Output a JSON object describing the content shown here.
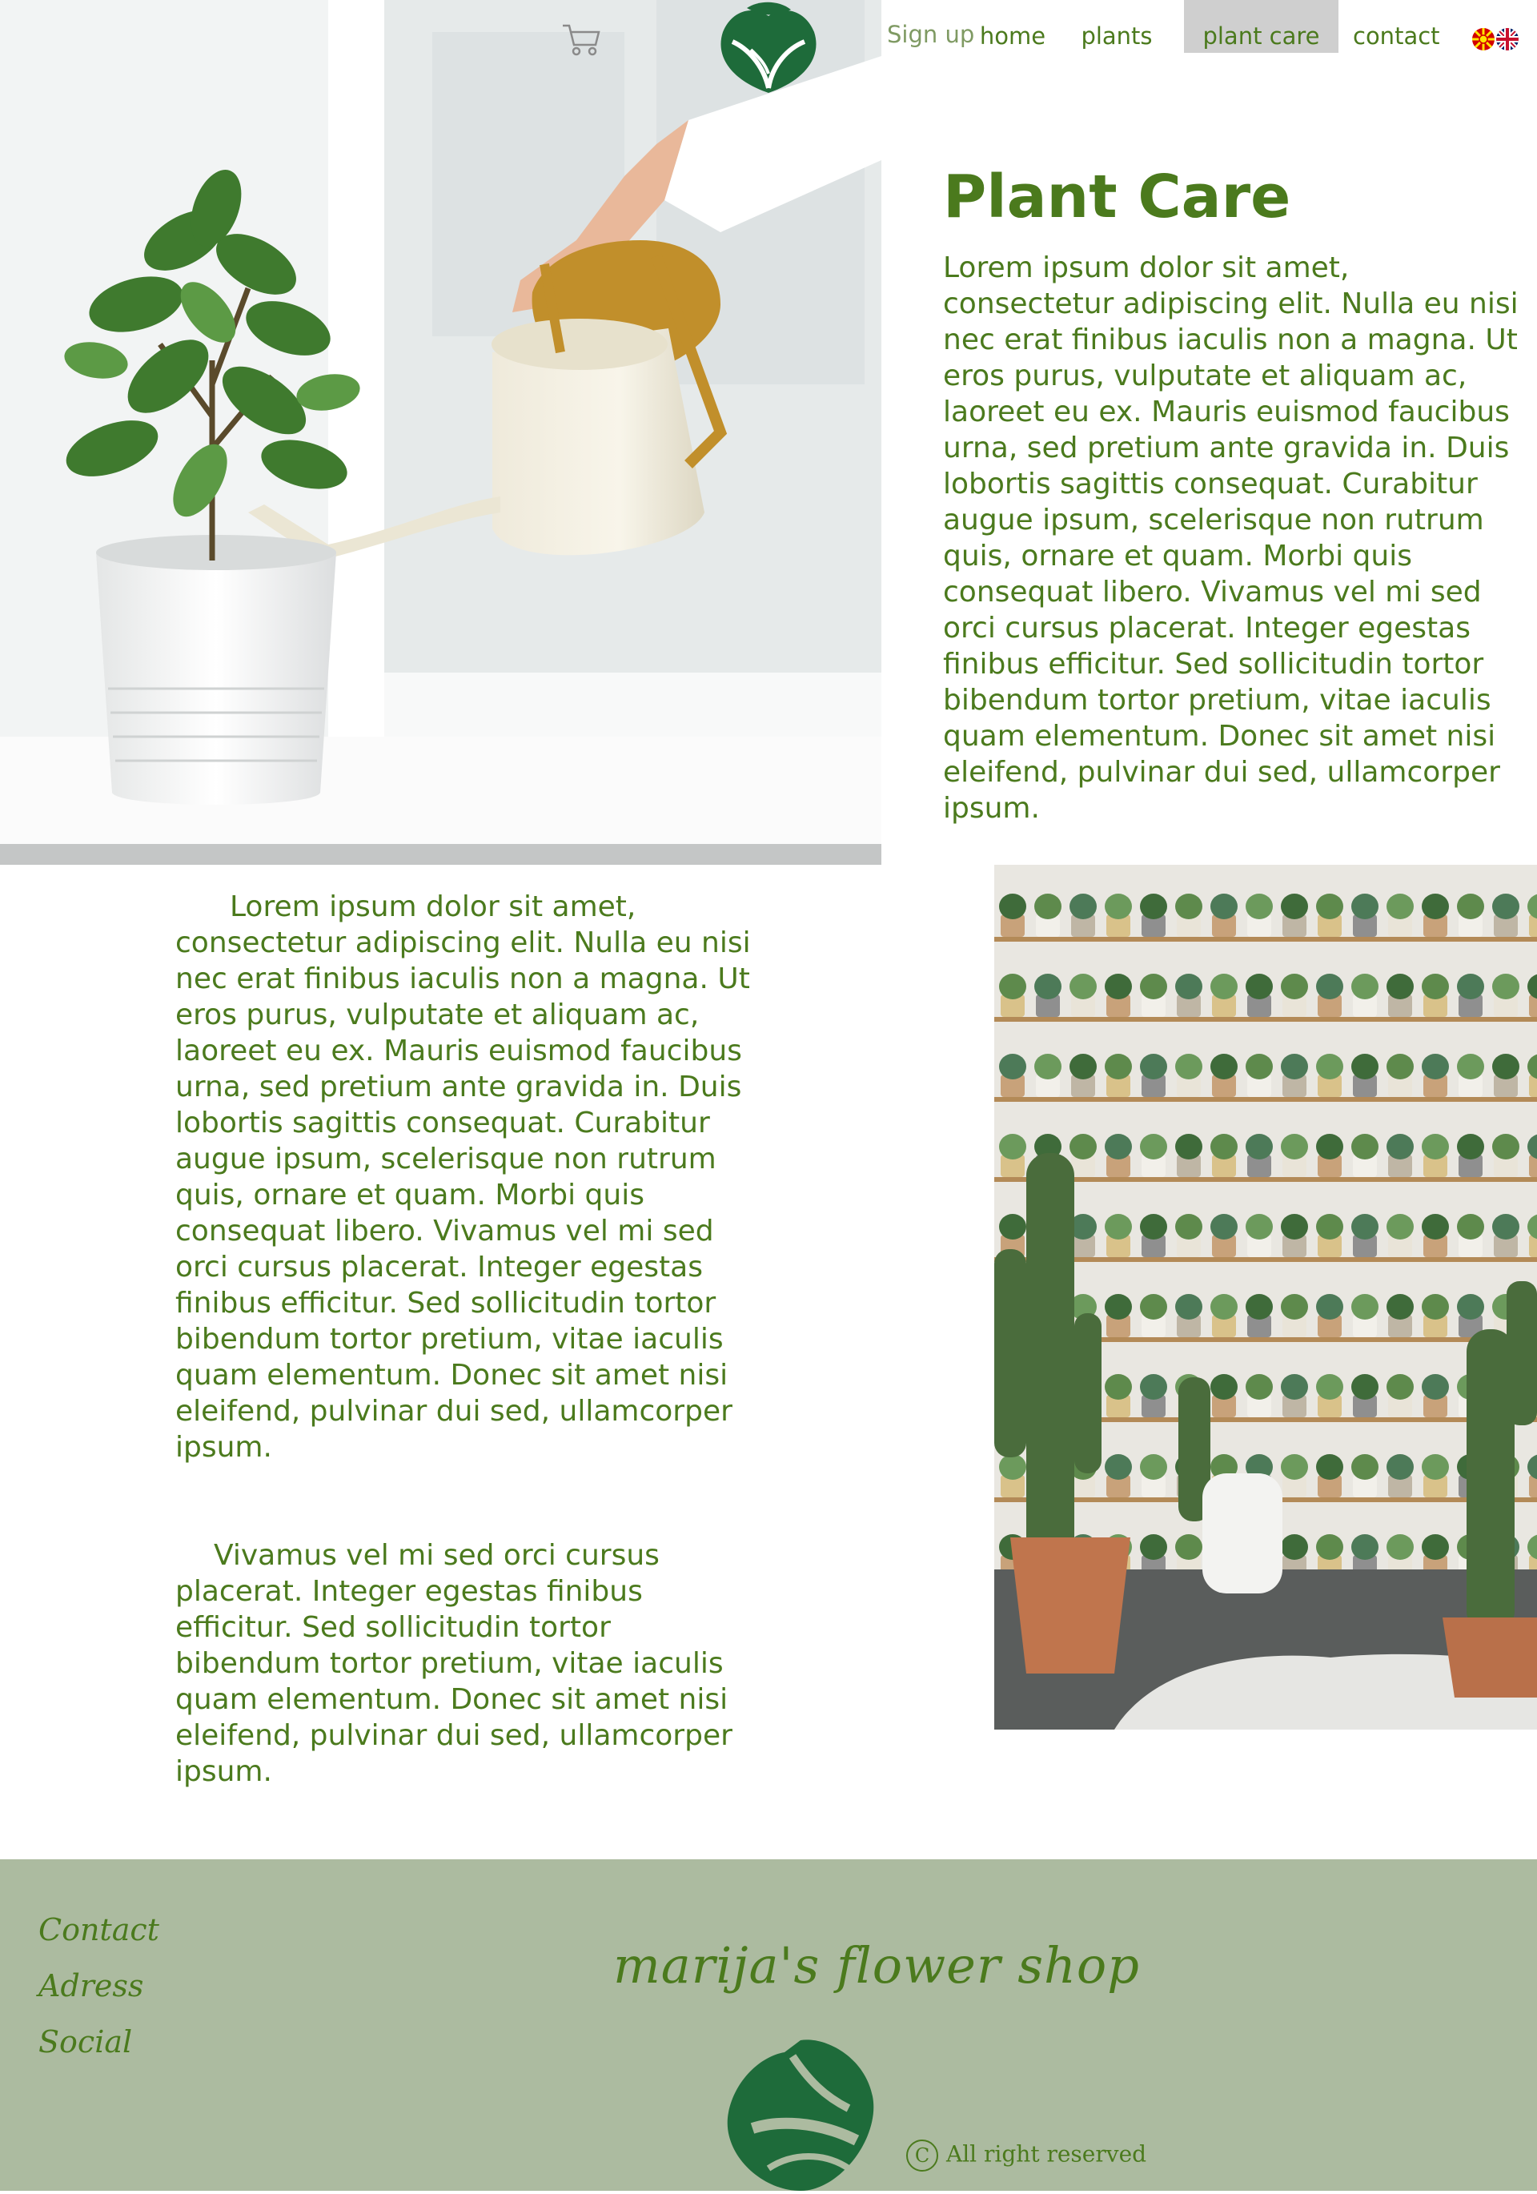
{
  "header": {
    "signup_label": "Sign up",
    "nav": [
      "home",
      "plants",
      "plant care",
      "contact"
    ],
    "active_nav": "plant care",
    "cart_icon": "cart-icon",
    "logo_icon": "leaf-logo-icon",
    "languages": [
      "mk-flag-icon",
      "uk-flag-icon"
    ]
  },
  "hero": {
    "title": "Plant Care",
    "intro": "Lorem ipsum dolor sit amet, consectetur adipiscing elit. Nulla eu nisi nec erat finibus iaculis non a magna. Ut eros purus, vulputate et aliquam ac, laoreet eu ex. Mauris euismod faucibus urna, sed pretium ante gravida in. Duis lobortis sagittis consequat. Curabitur augue ipsum, scelerisque non rutrum quis, ornare et quam. Morbi quis consequat libero. Vivamus vel mi sed orci cursus placerat. Integer egestas finibus efficitur. Sed sollicitudin tortor bibendum tortor pretium, vitae iaculis quam elementum. Donec sit amet nisi eleifend, pulvinar dui sed, ullamcorper ipsum."
  },
  "body": {
    "para1": "Lorem ipsum dolor sit amet, consectetur adipiscing elit. Nulla eu nisi nec erat finibus iaculis non a magna. Ut eros purus, vulputate et aliquam ac, laoreet eu ex. Mauris euismod faucibus urna, sed pretium ante gravida in. Duis lobortis sagittis consequat. Curabitur augue ipsum, scelerisque non rutrum quis, ornare et quam. Morbi quis consequat libero. Vivamus vel mi sed orci cursus placerat. Integer egestas finibus efficitur. Sed sollicitudin tortor bibendum tortor pretium, vitae iaculis quam elementum. Donec sit amet nisi eleifend, pulvinar dui sed, ullamcorper ipsum.",
    "para2": "Vivamus vel mi sed orci cursus placerat. Integer egestas finibus efficitur. Sed sollicitudin tortor bibendum tortor pretium, vitae iaculis quam elementum. Donec sit amet nisi eleifend, pulvinar dui sed, ullamcorper ipsum."
  },
  "footer": {
    "links": [
      "Contact",
      "Adress",
      "Social"
    ],
    "shop_name": "marija's flower shop",
    "copyright_symbol": "C",
    "copyright": "All right reserved"
  },
  "colors": {
    "brand_green": "#4b7a1d",
    "logo_green": "#1e6b3a",
    "footer_bg": "#acbba0",
    "active_nav_bg": "#cfcfcf"
  }
}
